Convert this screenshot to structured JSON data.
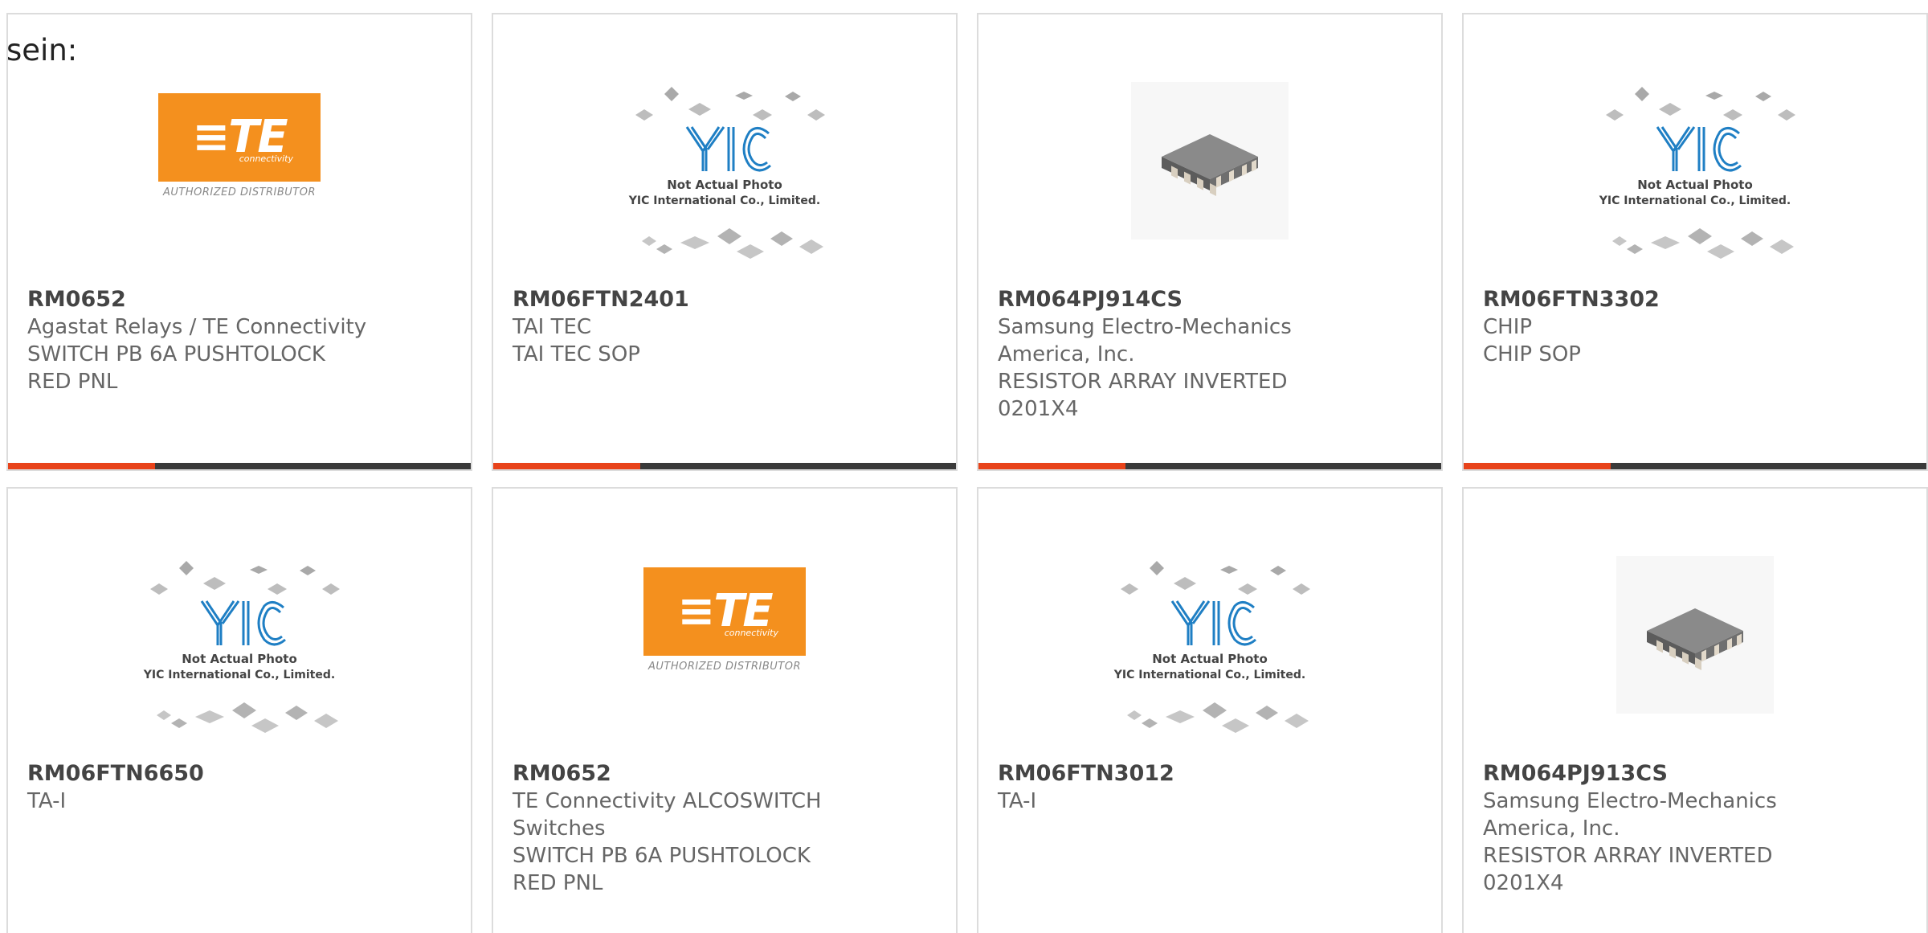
{
  "intro_text": "sein:",
  "colors": {
    "accent": "#e8431a",
    "bar": "#3a3a3a",
    "te_orange": "#f4901e",
    "yic_blue": "#1f7fc4"
  },
  "placeholder_image": {
    "line1": "Not Actual Photo",
    "line2": "YIC International Co., Limited.",
    "logo": "YIC"
  },
  "te_logo": {
    "mark": "TE",
    "connectivity": "connectivity",
    "subtitle": "AUTHORIZED DISTRIBUTOR"
  },
  "products": [
    {
      "image": "te-logo",
      "part_number": "RM0652",
      "lines": [
        "Agastat Relays / TE Connectivity",
        "SWITCH PB 6A PUSHTOLOCK",
        "RED PNL",
        ""
      ]
    },
    {
      "image": "yic-placeholder",
      "part_number": "RM06FTN2401",
      "lines": [
        "TAI TEC",
        "TAI TEC SOP",
        "",
        ""
      ]
    },
    {
      "image": "resistor-array",
      "part_number": "RM064PJ914CS",
      "lines": [
        "Samsung Electro-Mechanics",
        "America, Inc.",
        "RESISTOR ARRAY INVERTED",
        "0201X4"
      ]
    },
    {
      "image": "yic-placeholder",
      "part_number": "RM06FTN3302",
      "lines": [
        "CHIP",
        "CHIP SOP",
        "",
        ""
      ]
    },
    {
      "image": "yic-placeholder",
      "part_number": "RM06FTN6650",
      "lines": [
        "TA-I",
        "",
        "",
        ""
      ]
    },
    {
      "image": "te-logo",
      "part_number": "RM0652",
      "lines": [
        "TE Connectivity ALCOSWITCH",
        "Switches",
        "SWITCH PB 6A PUSHTOLOCK",
        "RED PNL"
      ]
    },
    {
      "image": "yic-placeholder",
      "part_number": "RM06FTN3012",
      "lines": [
        "TA-I",
        "",
        "",
        ""
      ]
    },
    {
      "image": "resistor-array",
      "part_number": "RM064PJ913CS",
      "lines": [
        "Samsung Electro-Mechanics",
        "America, Inc.",
        "RESISTOR ARRAY INVERTED",
        "0201X4"
      ]
    }
  ]
}
